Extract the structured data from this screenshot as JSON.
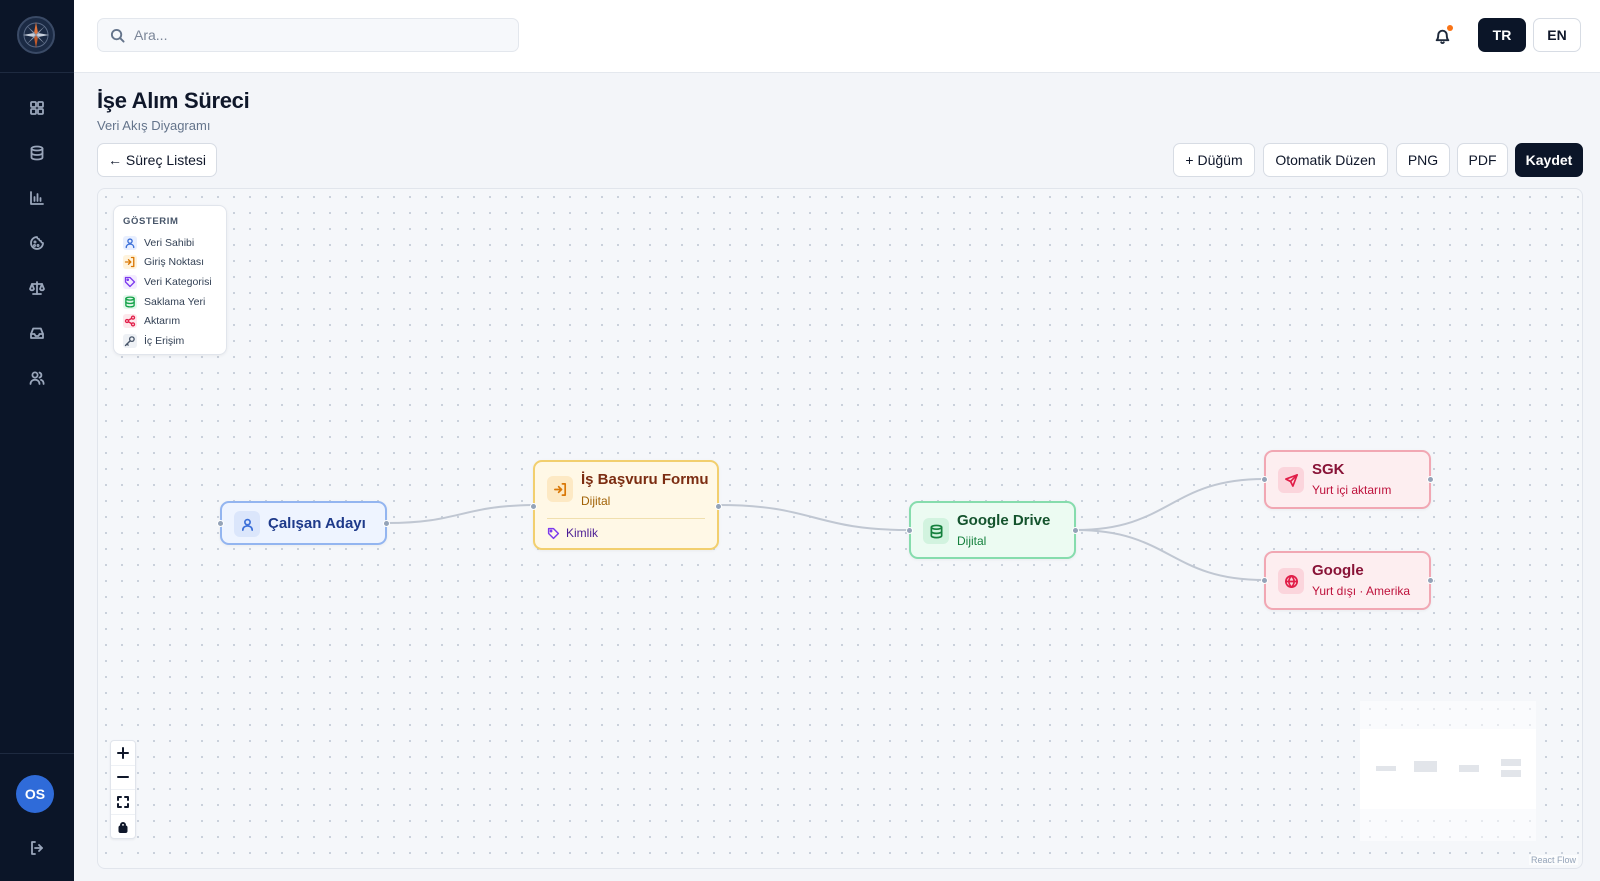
{
  "app": {
    "logo": "compass-logo"
  },
  "sidebar": {
    "items": [
      {
        "name": "dashboard",
        "icon": "grid-icon"
      },
      {
        "name": "inventory",
        "icon": "database-icon"
      },
      {
        "name": "reports",
        "icon": "bar-chart-icon"
      },
      {
        "name": "cookies",
        "icon": "cookie-icon"
      },
      {
        "name": "legal",
        "icon": "scale-icon"
      },
      {
        "name": "inbox",
        "icon": "inbox-icon"
      },
      {
        "name": "users",
        "icon": "users-icon"
      }
    ],
    "avatar": "OS",
    "logout_icon": "logout-icon"
  },
  "topbar": {
    "search_placeholder": "Ara...",
    "notifications_icon": "bell-icon",
    "lang_tr": "TR",
    "lang_en": "EN",
    "active_lang": "TR"
  },
  "page": {
    "title": "İşe Alım Süreci",
    "subtitle": "Veri Akış Diyagramı",
    "back_button": "← Süreç Listesi"
  },
  "toolbar": {
    "add_node": "+ Düğüm",
    "auto_layout": "Otomatik Düzen",
    "png": "PNG",
    "pdf": "PDF",
    "save": "Kaydet"
  },
  "legend": {
    "title": "GÖSTERIM",
    "items": [
      {
        "label": "Veri Sahibi",
        "icon": "user-icon",
        "color": "#3b6fd8"
      },
      {
        "label": "Giriş Noktası",
        "icon": "login-icon",
        "color": "#d97706"
      },
      {
        "label": "Veri Kategorisi",
        "icon": "tag-icon",
        "color": "#7c3aed"
      },
      {
        "label": "Saklama Yeri",
        "icon": "database-icon",
        "color": "#16a34a"
      },
      {
        "label": "Aktarım",
        "icon": "share-icon",
        "color": "#e11d48"
      },
      {
        "label": "İç Erişim",
        "icon": "key-icon",
        "color": "#475569"
      }
    ]
  },
  "nodes": {
    "candidate": {
      "title": "Çalışan Adayı",
      "icon": "user-icon"
    },
    "form": {
      "title": "İş Başvuru Formu",
      "subtitle": "Dijital",
      "tag": "Kimlik",
      "icon": "login-icon",
      "tag_icon": "tag-icon"
    },
    "drive": {
      "title": "Google Drive",
      "subtitle": "Dijital",
      "icon": "database-icon"
    },
    "sgk": {
      "title": "SGK",
      "subtitle": "Yurt içi aktarım",
      "icon": "send-icon"
    },
    "google": {
      "title": "Google",
      "subtitle": "Yurt dışı · Amerika",
      "icon": "globe-icon"
    }
  },
  "controls": {
    "zoom_in": "zoom-in-icon",
    "zoom_out": "zoom-out-icon",
    "fit_view": "fit-view-icon",
    "lock": "lock-icon"
  },
  "attribution": "React Flow",
  "colors": {
    "sidebar_bg": "#0b1528",
    "primary": "#0b1528",
    "avatar_bg": "#2f6bd9",
    "notification_dot": "#f97316"
  }
}
